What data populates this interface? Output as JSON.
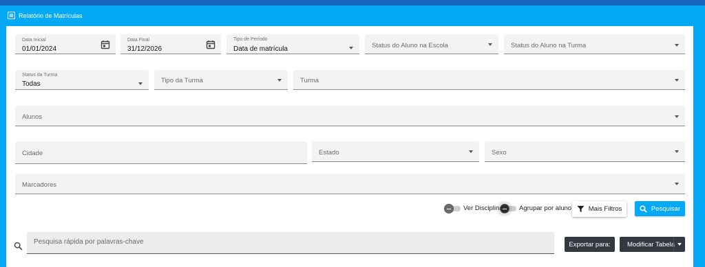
{
  "header": {
    "title": "Relatório de Matrículas",
    "icon": "report-icon"
  },
  "filters": {
    "data_inicial": {
      "label": "Data Inicial",
      "value": "01/01/2024",
      "icon": "calendar-icon"
    },
    "data_final": {
      "label": "Data Final",
      "value": "31/12/2026",
      "icon": "calendar-icon"
    },
    "tipo_periodo": {
      "label": "Tipo de Período",
      "value": "Data de matrícula"
    },
    "status_aluno_escola": {
      "label": "Status do Aluno na Escola"
    },
    "status_aluno_turma": {
      "label": "Status do Aluno na Turma"
    },
    "status_turma": {
      "label": "Status da Turma",
      "value": "Todas"
    },
    "tipo_turma": {
      "label": "Tipo da Turma"
    },
    "turma": {
      "label": "Turma"
    },
    "alunos": {
      "label": "Alunos"
    },
    "cidade": {
      "label": "Cidade"
    },
    "estado": {
      "label": "Estado"
    },
    "sexo": {
      "label": "Sexo"
    },
    "marcadores": {
      "label": "Marcadores"
    }
  },
  "toggles": {
    "ver_disciplinas": {
      "label": "Ver Disciplinas",
      "on": false
    },
    "agrupar_por_aluno": {
      "label": "Agrupar por aluno",
      "on": false
    }
  },
  "actions": {
    "mais_filtros": {
      "label": "Mais Filtros",
      "icon": "filter-icon"
    },
    "pesquisar": {
      "label": "Pesquisar",
      "icon": "search-icon"
    }
  },
  "quick_search": {
    "placeholder": "Pesquisa rápida por palavras-chave",
    "icon": "search-icon"
  },
  "table_tools": {
    "exportar": {
      "label": "Exportar para:"
    },
    "modificar": {
      "label": "Modificar Tabela"
    }
  },
  "colors": {
    "header": "#03a9f4",
    "topband": "#1565c0",
    "dark_button": "#33373f"
  }
}
